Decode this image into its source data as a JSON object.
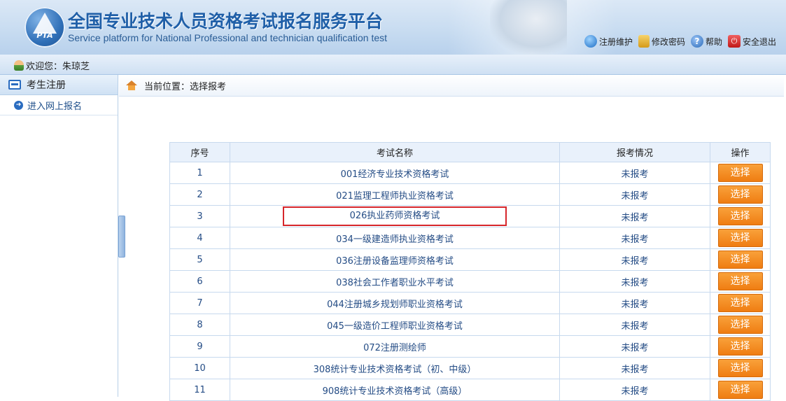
{
  "header": {
    "logo_text": "PTA",
    "title_cn": "全国专业技术人员资格考试报名服务平台",
    "title_en": "Service platform for National Professional and technician qualification test",
    "links": [
      {
        "label": "注册维护",
        "icon": "registration-maintenance-icon"
      },
      {
        "label": "修改密码",
        "icon": "lock-icon"
      },
      {
        "label": "帮助",
        "icon": "help-icon"
      },
      {
        "label": "安全退出",
        "icon": "power-icon"
      }
    ]
  },
  "welcome": {
    "label": "欢迎您：",
    "user": "朱琼芝"
  },
  "sidebar": {
    "heading": "考生注册",
    "items": [
      {
        "label": "进入网上报名"
      }
    ]
  },
  "breadcrumb": {
    "text": "当前位置：选择报考"
  },
  "table": {
    "headers": {
      "index": "序号",
      "name": "考试名称",
      "status": "报考情况",
      "action": "操作"
    },
    "rows": [
      {
        "index": "1",
        "name": "001经济专业技术资格考试",
        "status": "未报考",
        "action": "选择"
      },
      {
        "index": "2",
        "name": "021监理工程师执业资格考试",
        "status": "未报考",
        "action": "选择"
      },
      {
        "index": "3",
        "name": "026执业药师资格考试",
        "status": "未报考",
        "action": "选择"
      },
      {
        "index": "4",
        "name": "034一级建造师执业资格考试",
        "status": "未报考",
        "action": "选择"
      },
      {
        "index": "5",
        "name": "036注册设备监理师资格考试",
        "status": "未报考",
        "action": "选择"
      },
      {
        "index": "6",
        "name": "038社会工作者职业水平考试",
        "status": "未报考",
        "action": "选择"
      },
      {
        "index": "7",
        "name": "044注册城乡规划师职业资格考试",
        "status": "未报考",
        "action": "选择"
      },
      {
        "index": "8",
        "name": "045一级造价工程师职业资格考试",
        "status": "未报考",
        "action": "选择"
      },
      {
        "index": "9",
        "name": "072注册测绘师",
        "status": "未报考",
        "action": "选择"
      },
      {
        "index": "10",
        "name": "308统计专业技术资格考试（初、中级）",
        "status": "未报考",
        "action": "选择"
      },
      {
        "index": "11",
        "name": "908统计专业技术资格考试（高级）",
        "status": "未报考",
        "action": "选择"
      }
    ]
  },
  "colors": {
    "accent": "#1f5fa8",
    "button": "#ef7d12",
    "highlight_border": "#d6262b"
  }
}
